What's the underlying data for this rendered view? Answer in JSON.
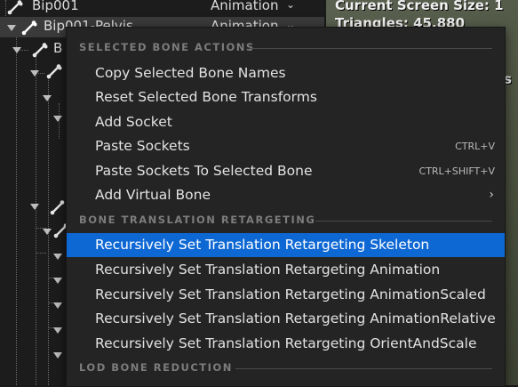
{
  "tree": {
    "rows": [
      {
        "name": "Bip001",
        "column": "Animation",
        "selected": false
      },
      {
        "name": "Bip001-Pelvis",
        "column": "Animation",
        "selected": true
      },
      {
        "name": "B",
        "column": "",
        "selected": false
      }
    ]
  },
  "viewport": {
    "screen_size": "Current Screen Size: 1",
    "triangles": "Triangles: 45,880",
    "partial": "s"
  },
  "menu": {
    "sections": [
      {
        "label": "SELECTED BONE ACTIONS",
        "items": [
          {
            "label": "Copy Selected Bone Names",
            "shortcut": ""
          },
          {
            "label": "Reset Selected Bone Transforms",
            "shortcut": ""
          },
          {
            "label": "Add Socket",
            "shortcut": ""
          },
          {
            "label": "Paste Sockets",
            "shortcut": "CTRL+V"
          },
          {
            "label": "Paste Sockets To Selected Bone",
            "shortcut": "CTRL+SHIFT+V"
          },
          {
            "label": "Add Virtual Bone",
            "shortcut": "",
            "submenu": true
          }
        ]
      },
      {
        "label": "BONE TRANSLATION RETARGETING",
        "items": [
          {
            "label": "Recursively Set Translation Retargeting Skeleton",
            "highlighted": true
          },
          {
            "label": "Recursively Set Translation Retargeting Animation"
          },
          {
            "label": "Recursively Set Translation Retargeting AnimationScaled"
          },
          {
            "label": "Recursively Set Translation Retargeting AnimationRelative"
          },
          {
            "label": "Recursively Set Translation Retargeting OrientAndScale"
          }
        ]
      },
      {
        "label": "LOD BONE REDUCTION",
        "items": []
      }
    ]
  },
  "colors": {
    "highlight": "#0e68d4",
    "menu_bg": "#242424",
    "section_text": "#7c7c7c"
  }
}
